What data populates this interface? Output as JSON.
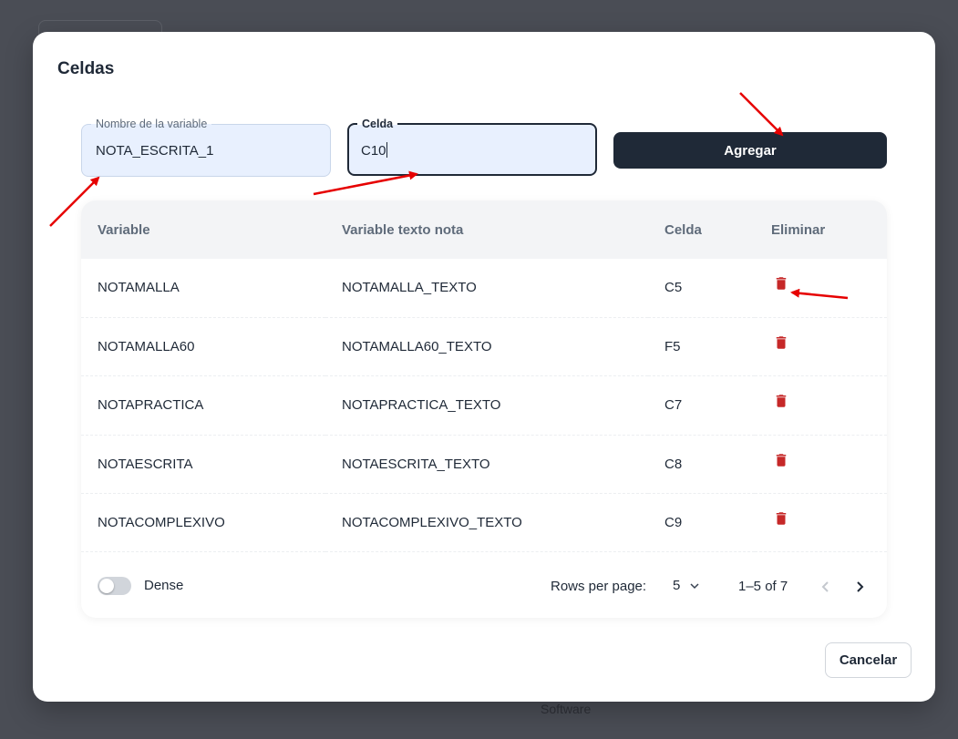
{
  "dialog": {
    "title": "Celdas",
    "name_field": {
      "label": "Nombre de la variable",
      "value": "NOTA_ESCRITA_1"
    },
    "cell_field": {
      "label": "Celda",
      "value": "C10"
    },
    "add_button": "Agregar",
    "cancel_button": "Cancelar"
  },
  "table": {
    "headers": [
      "Variable",
      "Variable texto nota",
      "Celda",
      "Eliminar"
    ],
    "rows": [
      {
        "variable": "NOTAMALLA",
        "texto": "NOTAMALLA_TEXTO",
        "celda": "C5"
      },
      {
        "variable": "NOTAMALLA60",
        "texto": "NOTAMALLA60_TEXTO",
        "celda": "F5"
      },
      {
        "variable": "NOTAPRACTICA",
        "texto": "NOTAPRACTICA_TEXTO",
        "celda": "C7"
      },
      {
        "variable": "NOTAESCRITA",
        "texto": "NOTAESCRITA_TEXTO",
        "celda": "C8"
      },
      {
        "variable": "NOTACOMPLEXIVO",
        "texto": "NOTACOMPLEXIVO_TEXTO",
        "celda": "C9"
      }
    ],
    "delete_icon": "trash-icon",
    "delete_color": "#c62828"
  },
  "pagination": {
    "dense_label": "Dense",
    "dense_enabled": false,
    "rows_per_page_label": "Rows per page:",
    "rows_per_page": "5",
    "range": "1–5 of 7"
  },
  "background": {
    "text": "Software"
  },
  "annotation_color": "#e60000"
}
